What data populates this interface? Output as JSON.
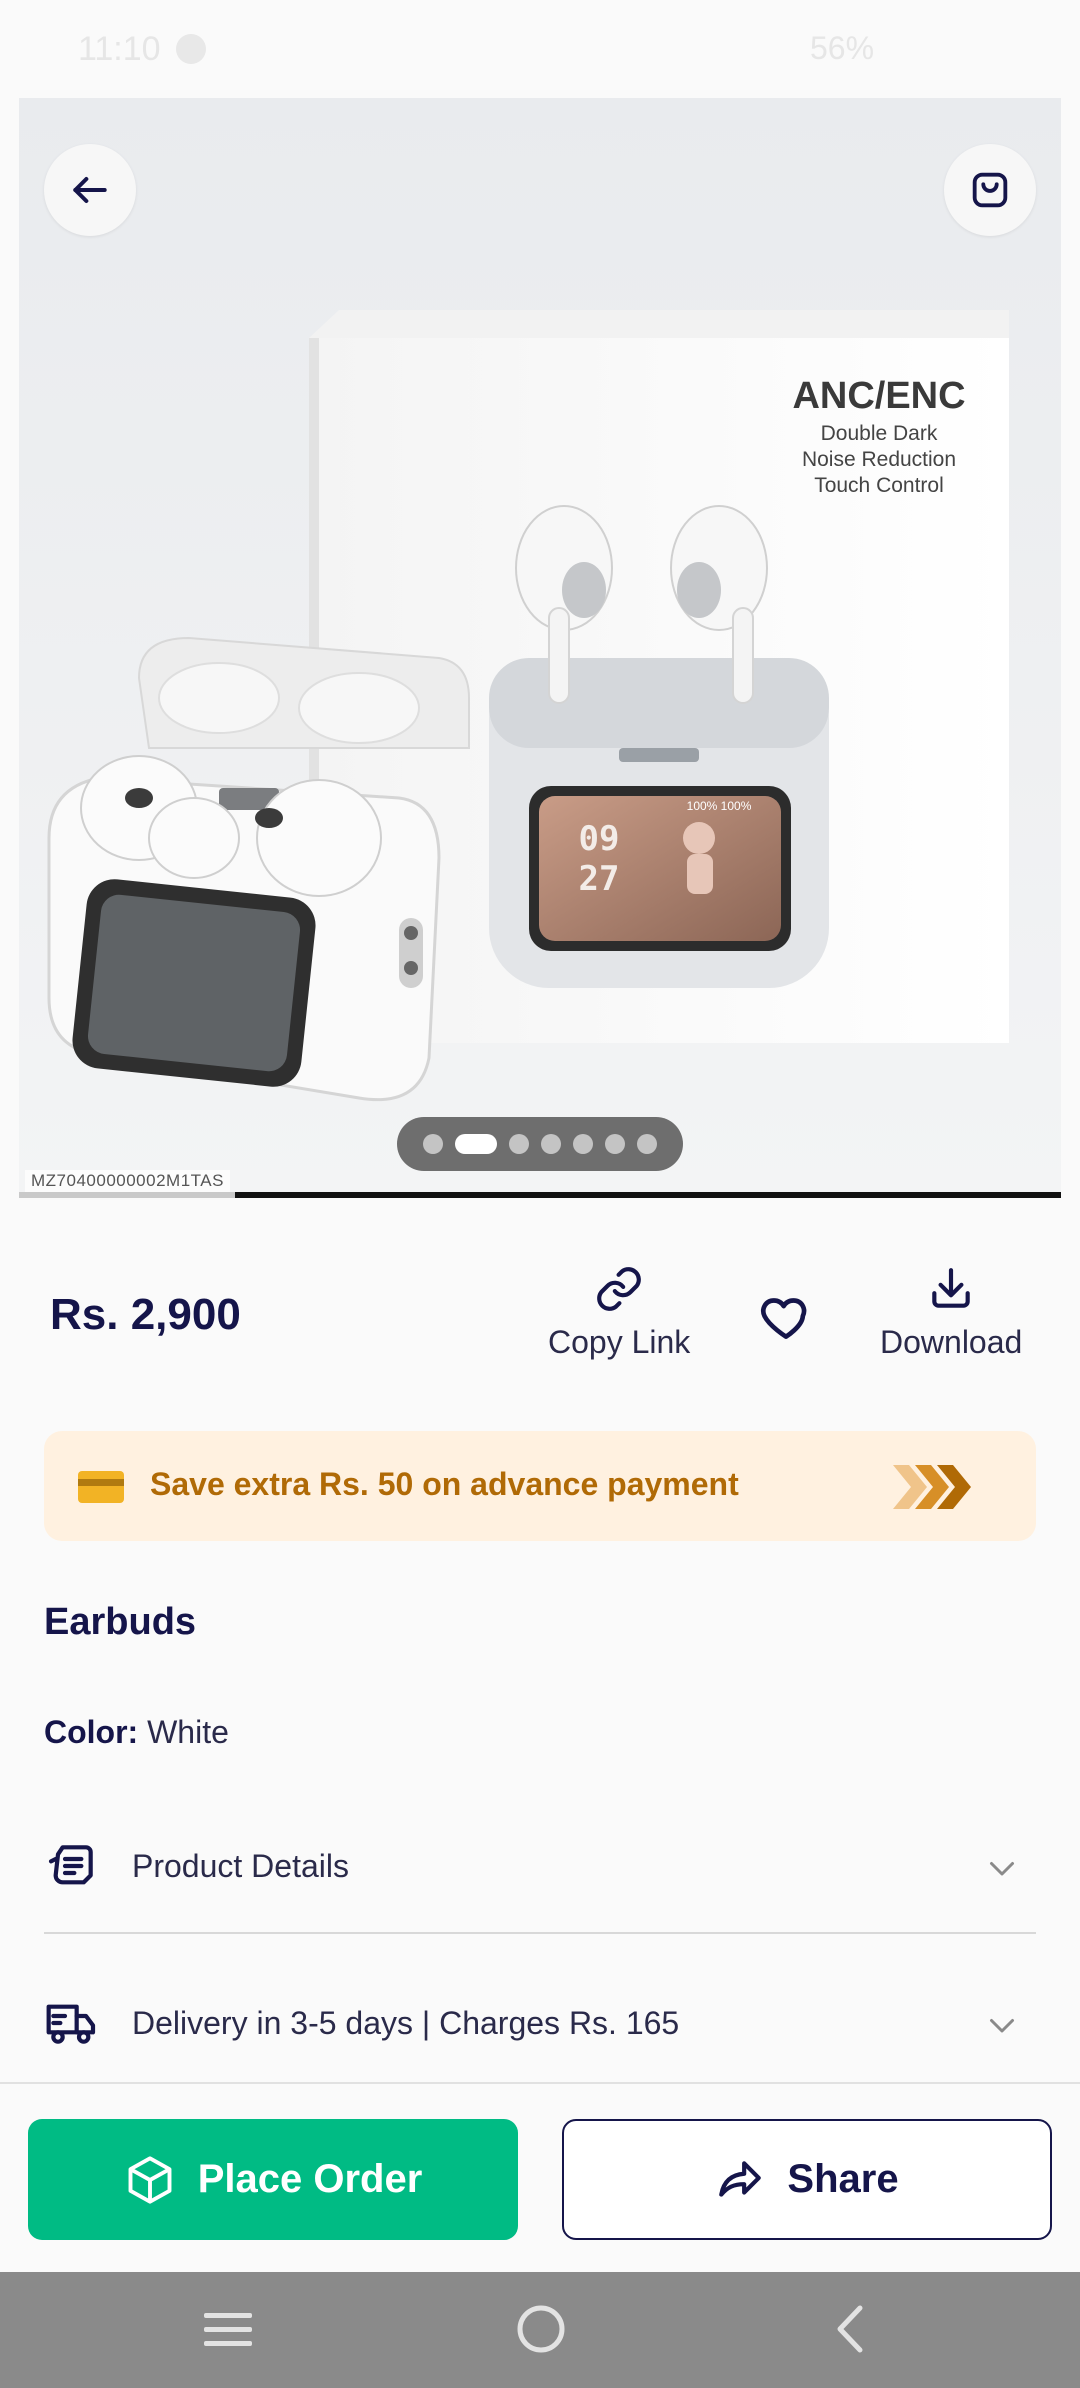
{
  "status_bar": {
    "time": "11:10",
    "battery": "56%"
  },
  "product_image": {
    "box_title": "ANC/ENC",
    "box_lines": [
      "Double Dark",
      "Noise Reduction",
      "Touch Control"
    ],
    "screen_time_hour": "09",
    "screen_time_min": "27",
    "screen_status": "100%  100%",
    "sku": "MZ70400000002M1TAS",
    "carousel_total": 7,
    "carousel_active": 2
  },
  "price": "Rs. 2,900",
  "actions": {
    "copy_link": "Copy Link",
    "download": "Download"
  },
  "banner": {
    "text": "Save extra Rs. 50 on advance payment",
    "accent": "#b06a06"
  },
  "product": {
    "title": "Earbuds",
    "color_label": "Color:",
    "color_value": "White"
  },
  "sections": {
    "product_details": "Product Details",
    "delivery": "Delivery in 3-5 days | Charges Rs. 165"
  },
  "buttons": {
    "place_order": "Place Order",
    "share": "Share"
  },
  "colors": {
    "primary": "#00bb84",
    "navy": "#15154a"
  }
}
